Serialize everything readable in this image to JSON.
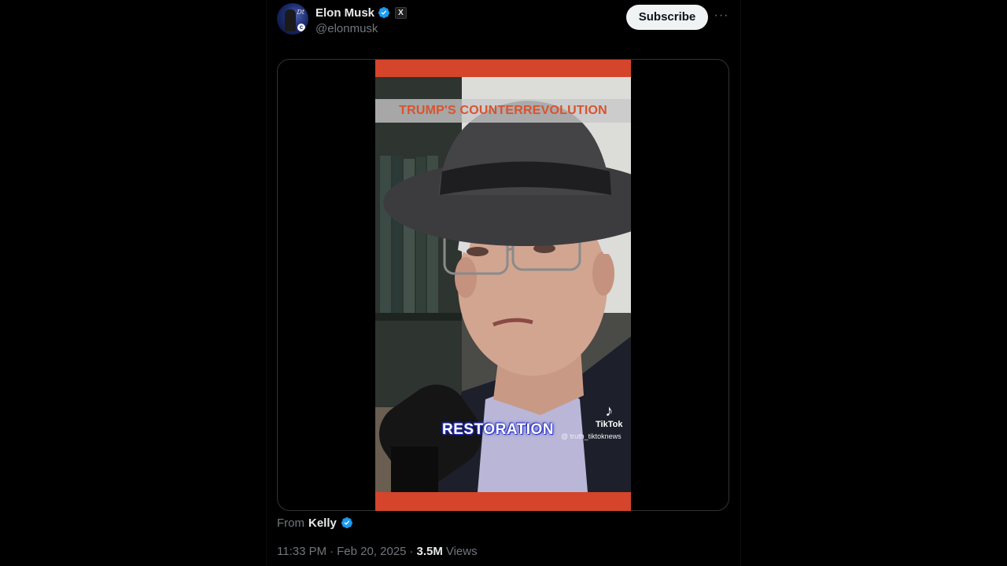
{
  "post": {
    "author": {
      "display_name": "Elon Musk",
      "handle": "@elonmusk",
      "verified": true,
      "affiliate_badge": "X"
    },
    "subscribe_label": "Subscribe",
    "more_label": "···",
    "video": {
      "top_caption": "TRUMP'S COUNTERREVOLUTION",
      "subtitle": "RESTORATION",
      "watermark_brand": "TikTok",
      "watermark_user": "@ truth_tiktoknews",
      "accent_color": "#d4452b"
    },
    "attribution": {
      "from_label": "From",
      "from_name": "Kelly",
      "verified": true
    },
    "meta": {
      "time": "11:33 PM",
      "separator1": "·",
      "date": "Feb 20, 2025",
      "separator2": "·",
      "views_count": "3.5M",
      "views_label": "Views"
    }
  },
  "colors": {
    "background": "#000000",
    "verified_blue": "#1d9bf0",
    "muted_text": "#71767b",
    "primary_text": "#e7e9ea",
    "button_bg": "#eff3f4"
  }
}
